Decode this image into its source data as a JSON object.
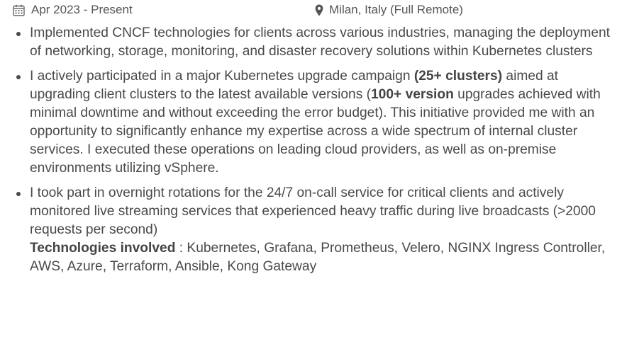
{
  "header": {
    "date_range": "Apr 2023 - Present",
    "location": "Milan, Italy (Full Remote)",
    "calendar_icon": "calendar-icon",
    "location_icon": "map-marker-icon"
  },
  "bullets": {
    "b1": {
      "text": "Implemented CNCF technologies for clients across various industries, managing the deployment of networking, storage, monitoring, and disaster recovery solutions within Kubernetes clusters"
    },
    "b2": {
      "t1": "I actively participated in a major Kubernetes upgrade campaign ",
      "bold1": "(25+ clusters)",
      "t2": " aimed at upgrading client clusters to the latest available versions (",
      "bold2": "100+ version",
      "t3": " upgrades achieved with minimal downtime and without exceeding the error budget). This initiative provided me with an opportunity to significantly enhance my expertise across a wide spectrum of internal cluster services. I executed these operations on leading cloud providers, as well as on-premise environments utilizing vSphere."
    },
    "b3": {
      "text": "I took part in overnight rotations for the 24/7 on-call service for critical clients and actively monitored live streaming services that experienced heavy traffic during live broadcasts (>2000 requests per second)",
      "tech_label": "Technologies involved",
      "tech_list": " : Kubernetes, Grafana, Prometheus, Velero, NGINX Ingress Controller, AWS, Azure, Terraform, Ansible, Kong Gateway"
    }
  }
}
